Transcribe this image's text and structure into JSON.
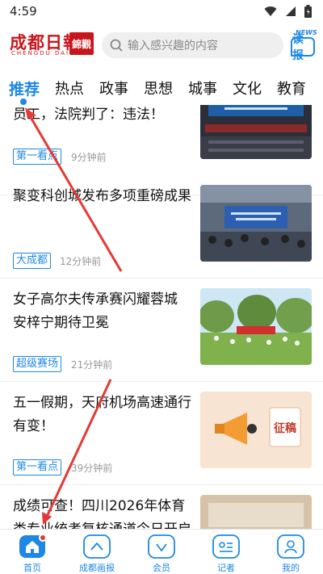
{
  "status_bar": {
    "time": "4:59"
  },
  "header": {
    "logo_cn": "成都日報",
    "logo_en": "CHENGDU DAILY",
    "logo_badge": "錦觀",
    "search_placeholder": "输入感兴趣的内容",
    "dubao_news": "NEWS",
    "dubao_label": "读报"
  },
  "tabs": [
    "推荐",
    "热点",
    "政事",
    "思想",
    "城事",
    "文化",
    "教育"
  ],
  "articles": [
    {
      "title": "员工，法院判了：违法！",
      "tag": "第一看点",
      "time": "9分钟前"
    },
    {
      "title": "聚变科创城发布多项重磅成果",
      "tag": "大成都",
      "time": "12分钟前"
    },
    {
      "title": "女子高尔夫传承赛闪耀蓉城 安梓宁期待卫冕",
      "tag": "超级赛场",
      "time": "21分钟前"
    },
    {
      "title": "五一假期，天府机场高速通行有变！",
      "tag": "第一看点",
      "time": "39分钟前",
      "thumb_text": "征稿"
    },
    {
      "title": "成绩可查！四川2026年体育类专业统考复核通道今日开启"
    }
  ],
  "bottom_nav": [
    "首页",
    "成都画报",
    "会员",
    "记者",
    "我的"
  ],
  "colors": {
    "accent": "#1e88e5",
    "brand_red": "#c8161d",
    "annotation": "#e53935"
  }
}
